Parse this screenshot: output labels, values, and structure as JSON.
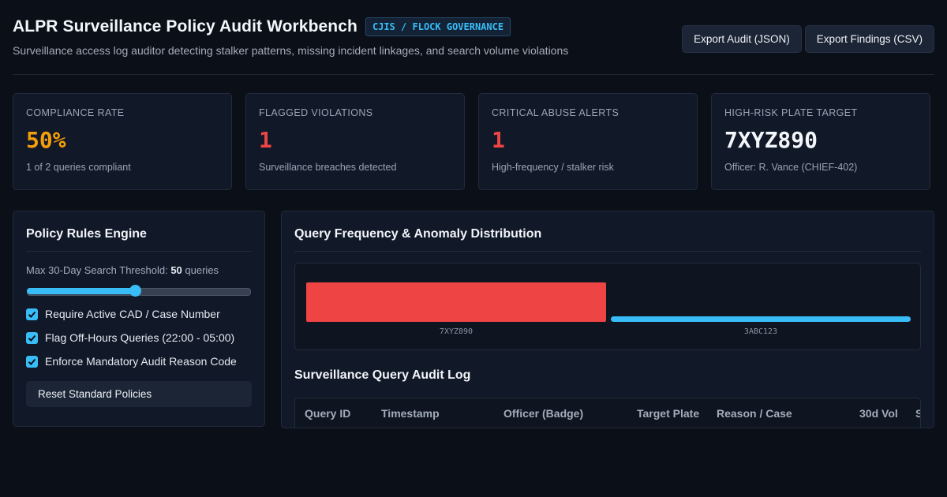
{
  "header": {
    "title": "ALPR Surveillance Policy Audit Workbench",
    "tag": "CJIS / FLOCK GOVERNANCE",
    "subtitle": "Surveillance access log auditor detecting stalker patterns, missing incident linkages, and search volume violations",
    "export_json_label": "Export Audit (JSON)",
    "export_csv_label": "Export Findings (CSV)"
  },
  "cards": [
    {
      "label": "COMPLIANCE RATE",
      "value": "50%",
      "note": "1 of 2 queries compliant",
      "color": "#f59e0b"
    },
    {
      "label": "FLAGGED VIOLATIONS",
      "value": "1",
      "note": "Surveillance breaches detected",
      "color": "#ef4444"
    },
    {
      "label": "CRITICAL ABUSE ALERTS",
      "value": "1",
      "note": "High-frequency / stalker risk",
      "color": "#ef4444"
    },
    {
      "label": "HIGH-RISK PLATE TARGET",
      "value": "7XYZ890",
      "note": "Officer: R. Vance (CHIEF-402)",
      "color": "#f3f6fa"
    }
  ],
  "rules": {
    "title": "Policy Rules Engine",
    "threshold_prefix": "Max 30-Day Search Threshold:",
    "threshold_value": "50",
    "threshold_suffix": "queries",
    "slider_fraction": 0.48,
    "checks": [
      {
        "label": "Require Active CAD / Case Number",
        "checked": true
      },
      {
        "label": "Flag Off-Hours Queries (22:00 - 05:00)",
        "checked": true
      },
      {
        "label": "Enforce Mandatory Audit Reason Code",
        "checked": true
      }
    ],
    "reset_label": "Reset Standard Policies"
  },
  "main": {
    "chart_title": "Query Frequency & Anomaly Distribution",
    "log_title": "Surveillance Query Audit Log",
    "columns": [
      "Query ID",
      "Timestamp",
      "Officer (Badge)",
      "Target Plate",
      "Reason / Case",
      "30d Vol",
      "S"
    ]
  },
  "chart_data": {
    "type": "bar",
    "categories": [
      "7XYZ890",
      "3ABC123"
    ],
    "values": [
      8.3,
      1
    ],
    "colors": [
      "#ef4444",
      "#38bdf8"
    ],
    "title": "Query Frequency & Anomaly Distribution",
    "xlabel": "",
    "ylabel": ""
  }
}
